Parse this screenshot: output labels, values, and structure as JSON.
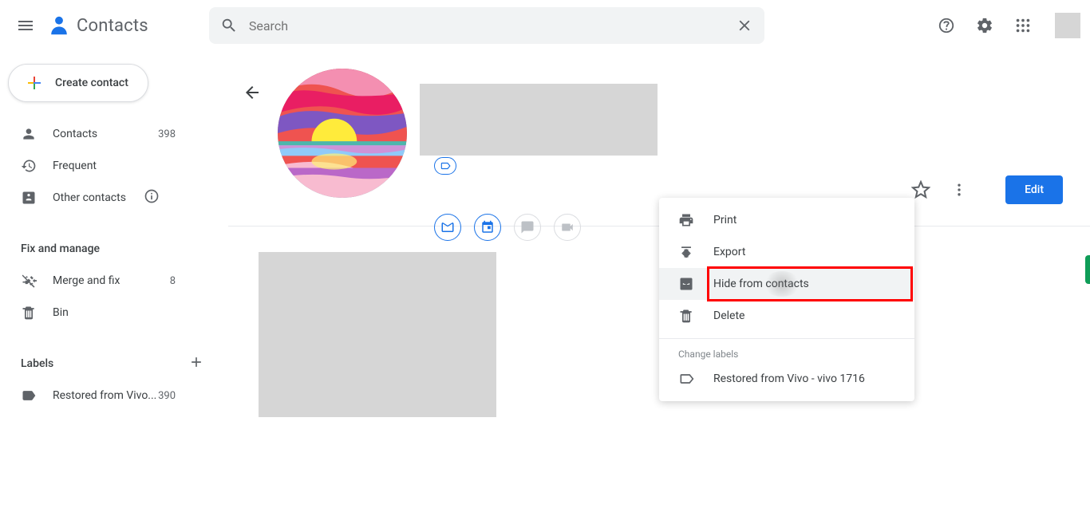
{
  "header": {
    "app_title": "Contacts",
    "search_placeholder": "Search"
  },
  "sidebar": {
    "create_label": "Create contact",
    "items": [
      {
        "label": "Contacts",
        "count": "398"
      },
      {
        "label": "Frequent"
      },
      {
        "label": "Other contacts"
      }
    ],
    "fix_header": "Fix and manage",
    "fix_items": [
      {
        "label": "Merge and fix",
        "count": "8"
      },
      {
        "label": "Bin"
      }
    ],
    "labels_header": "Labels",
    "labels": [
      {
        "label": "Restored from Vivo...",
        "count": "390"
      }
    ]
  },
  "contact": {
    "edit_label": "Edit"
  },
  "menu": {
    "print": "Print",
    "export": "Export",
    "hide": "Hide from contacts",
    "delete": "Delete",
    "change_labels": "Change labels",
    "label_item": "Restored from Vivo - vivo 1716"
  }
}
